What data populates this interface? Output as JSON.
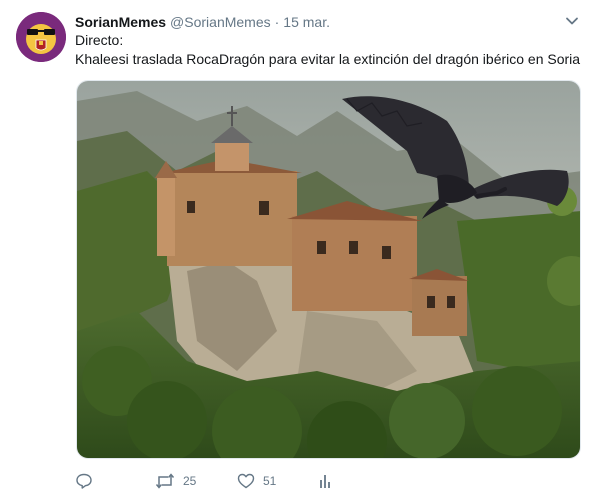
{
  "tweet": {
    "display_name": "SorianMemes",
    "handle": "@SorianMemes",
    "separator": "·",
    "timestamp": "15 mar.",
    "text_line1": "Directo:",
    "text_line2": "Khaleesi traslada RocaDragón para evitar la extinción del dragón ibérico en Soria"
  },
  "actions": {
    "retweet_count": "25",
    "like_count": "51"
  },
  "icons": {
    "avatar": "emoji-sunglasses-with-soria-shield",
    "caret": "chevron-down-icon",
    "reply": "reply-icon",
    "retweet": "retweet-icon",
    "like": "heart-icon",
    "analytics": "analytics-icon"
  },
  "colors": {
    "text_primary": "#14171a",
    "text_secondary": "#657786",
    "avatar_bg": "#7a2a7c",
    "border": "#e1e8ed"
  }
}
